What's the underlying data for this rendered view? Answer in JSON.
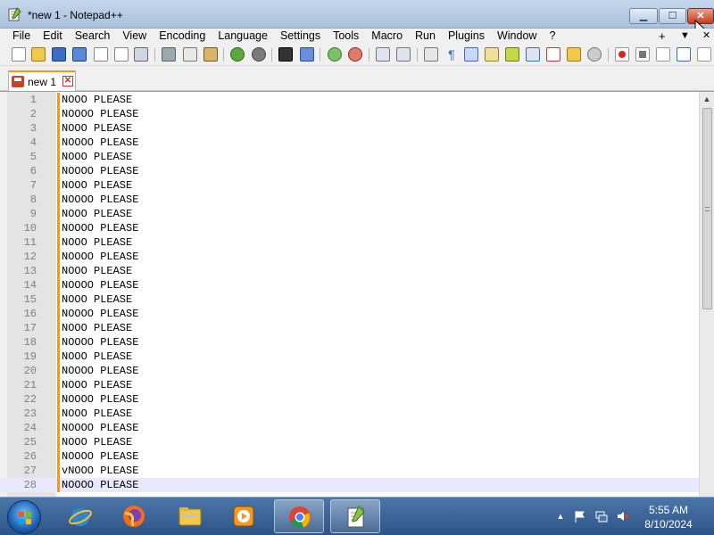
{
  "window": {
    "title": "*new 1 - Notepad++",
    "min_glyph": "▁",
    "max_glyph": "☐",
    "close_glyph": "✕"
  },
  "menu": {
    "items": [
      "File",
      "Edit",
      "Search",
      "View",
      "Encoding",
      "Language",
      "Settings",
      "Tools",
      "Macro",
      "Run",
      "Plugins",
      "Window",
      "?"
    ],
    "plus": "+",
    "dropdown": "▼",
    "close": "✕"
  },
  "tab": {
    "label": "new 1",
    "close_glyph": "✕"
  },
  "editor": {
    "current_line": 28,
    "lines": [
      {
        "n": "1",
        "text": "NOOO PLEASE"
      },
      {
        "n": "2",
        "text": "NOOOO PLEASE"
      },
      {
        "n": "3",
        "text": "NOOO PLEASE"
      },
      {
        "n": "4",
        "text": "NOOOO PLEASE"
      },
      {
        "n": "5",
        "text": "NOOO PLEASE"
      },
      {
        "n": "6",
        "text": "NOOOO PLEASE"
      },
      {
        "n": "7",
        "text": "NOOO PLEASE"
      },
      {
        "n": "8",
        "text": "NOOOO PLEASE"
      },
      {
        "n": "9",
        "text": "NOOO PLEASE"
      },
      {
        "n": "10",
        "text": "NOOOO PLEASE"
      },
      {
        "n": "11",
        "text": "NOOO PLEASE"
      },
      {
        "n": "12",
        "text": "NOOOO PLEASE"
      },
      {
        "n": "13",
        "text": "NOOO PLEASE"
      },
      {
        "n": "14",
        "text": "NOOOO PLEASE"
      },
      {
        "n": "15",
        "text": "NOOO PLEASE"
      },
      {
        "n": "16",
        "text": "NOOOO PLEASE"
      },
      {
        "n": "17",
        "text": "NOOO PLEASE"
      },
      {
        "n": "18",
        "text": "NOOOO PLEASE"
      },
      {
        "n": "19",
        "text": "NOOO PLEASE"
      },
      {
        "n": "20",
        "text": "NOOOO PLEASE"
      },
      {
        "n": "21",
        "text": "NOOO PLEASE"
      },
      {
        "n": "22",
        "text": "NOOOO PLEASE"
      },
      {
        "n": "23",
        "text": "NOOO PLEASE"
      },
      {
        "n": "24",
        "text": "NOOOO PLEASE"
      },
      {
        "n": "25",
        "text": "NOOO PLEASE"
      },
      {
        "n": "26",
        "text": "NOOOO PLEASE"
      },
      {
        "n": "27",
        "text": "vNOOO PLEASE"
      },
      {
        "n": "28",
        "text": "NOOOO PLEASE"
      }
    ]
  },
  "scrollbar": {
    "up_glyph": "▲"
  },
  "taskbar": {
    "apps": [
      "internet-explorer",
      "firefox",
      "file-explorer",
      "media-player",
      "chrome",
      "notepad-plus-plus"
    ],
    "active_app": "notepad-plus-plus",
    "tray_expand": "▲",
    "time": "5:55 AM",
    "date": "8/10/2024"
  },
  "colors": {
    "accent_orange": "#f29a1b",
    "current_line": "#e8e8ff",
    "line_number": "#808080",
    "taskbar": "#2e5486"
  }
}
